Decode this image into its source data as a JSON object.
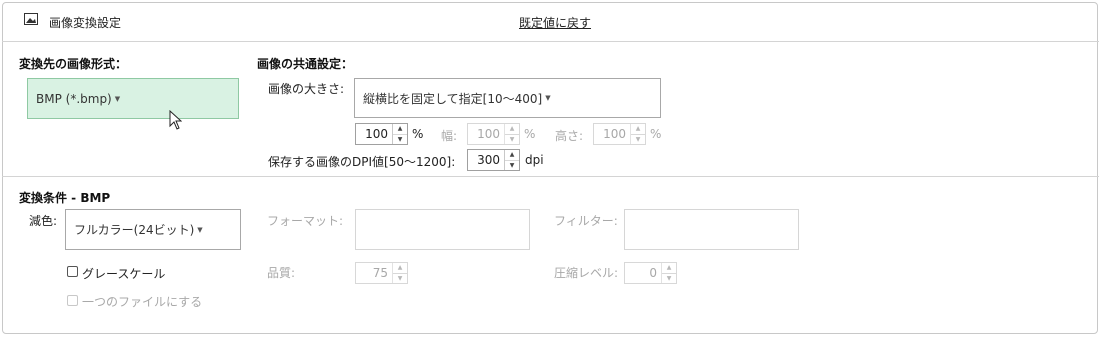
{
  "header": {
    "title": "画像変換設定",
    "reset_label": "既定値に戻す",
    "icon": "image-icon"
  },
  "target_format": {
    "heading": "変換先の画像形式：",
    "selected": "BMP (*.bmp)"
  },
  "common": {
    "heading": "画像の共通設定：",
    "size_label": "画像の大きさ:",
    "size_mode": "縦横比を固定して指定[10～400]",
    "percent_value": "100",
    "percent_unit": "%",
    "width_label": "幅:",
    "width_value": "100",
    "width_unit": "%",
    "height_label": "高さ:",
    "height_value": "100",
    "height_unit": "%",
    "dpi_label": "保存する画像のDPI値[50～1200]:",
    "dpi_value": "300",
    "dpi_unit": "dpi"
  },
  "conditions": {
    "heading": "変換条件 - BMP",
    "color_label": "減色:",
    "color_value": "フルカラー(24ビット)",
    "format_label": "フォーマット:",
    "filter_label": "フィルター:",
    "grayscale_label": "グレースケール",
    "single_file_label": "一つのファイルにする",
    "quality_label": "品質:",
    "quality_value": "75",
    "compression_label": "圧縮レベル:",
    "compression_value": "0"
  }
}
